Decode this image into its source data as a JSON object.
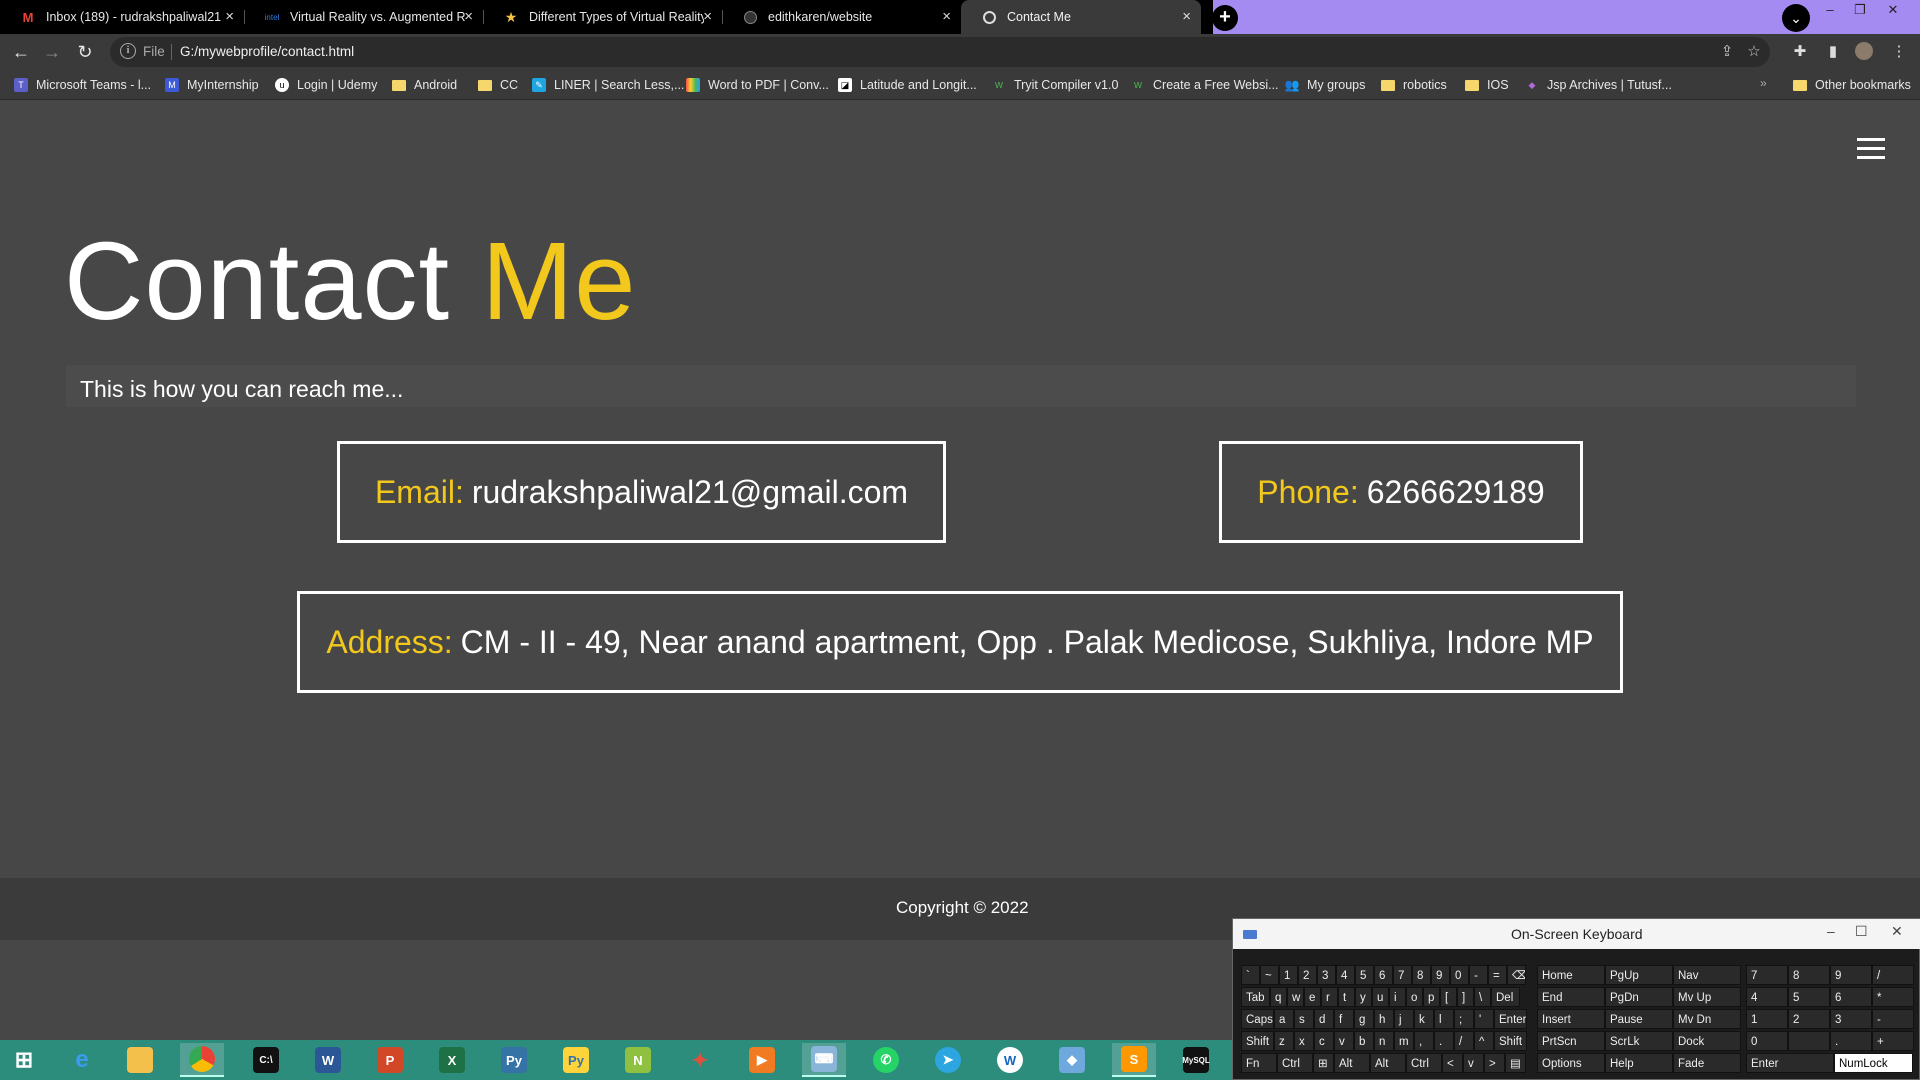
{
  "browser": {
    "tabs": [
      {
        "title": "Inbox (189) - rudrakshpaliwal21@",
        "icon": "gmail-icon",
        "active": false
      },
      {
        "title": "Virtual Reality vs. Augmented Re",
        "icon": "intel-icon",
        "active": false
      },
      {
        "title": "Different Types of Virtual Reality",
        "icon": "star-icon",
        "active": false
      },
      {
        "title": "edithkaren/website",
        "icon": "github-icon",
        "active": false
      },
      {
        "title": "Contact Me",
        "icon": "globe-icon",
        "active": true
      }
    ],
    "address": {
      "scheme": "File",
      "url": "G:/mywebprofile/contact.html"
    },
    "bookmarks": [
      {
        "label": "Microsoft Teams - l...",
        "icon": "teams-icon"
      },
      {
        "label": "MyInternship",
        "icon": "myinternship-icon"
      },
      {
        "label": "Login | Udemy",
        "icon": "udemy-icon"
      },
      {
        "label": "Android",
        "icon": "folder-icon"
      },
      {
        "label": "CC",
        "icon": "folder-icon"
      },
      {
        "label": "LINER | Search Less,...",
        "icon": "liner-icon"
      },
      {
        "label": "Word to PDF | Conv...",
        "icon": "pdf-icon"
      },
      {
        "label": "Latitude and Longit...",
        "icon": "map-icon"
      },
      {
        "label": "Tryit Compiler v1.0",
        "icon": "w3-icon"
      },
      {
        "label": "Create a Free Websi...",
        "icon": "w3-icon"
      },
      {
        "label": "My groups",
        "icon": "groups-icon"
      },
      {
        "label": "robotics",
        "icon": "folder-icon"
      },
      {
        "label": "IOS",
        "icon": "folder-icon"
      },
      {
        "label": "Jsp Archives | Tutusf...",
        "icon": "jsp-icon"
      }
    ],
    "bookmarks_more": "»",
    "other_bookmarks": "Other bookmarks"
  },
  "page": {
    "heading_main": "Contact",
    "heading_accent": "Me",
    "subline": "This is how you can reach me...",
    "email_label": "Email:",
    "email_value": "rudrakshpaliwal21@gmail.com",
    "phone_label": "Phone:",
    "phone_value": "6266629189",
    "address_label": "Address:",
    "address_value": "CM - II - 49, Near anand apartment, Opp . Palak Medicose, Sukhliya, Indore MP",
    "footer": "Copyright © 2022",
    "colors": {
      "accent": "#f2c81c",
      "background": "#474747"
    }
  },
  "osk": {
    "title": "On-Screen Keyboard",
    "rows": [
      [
        "`",
        "~",
        "1",
        "2",
        "3",
        "4",
        "5",
        "6",
        "7",
        "8",
        "9",
        "0",
        "-",
        "=",
        "⌫"
      ],
      [
        "Tab",
        "q",
        "w",
        "e",
        "r",
        "t",
        "y",
        "u",
        "i",
        "o",
        "p",
        "[",
        "]",
        "\\",
        "Del"
      ],
      [
        "Caps",
        "a",
        "s",
        "d",
        "f",
        "g",
        "h",
        "j",
        "k",
        "l",
        ";",
        "'",
        "Enter"
      ],
      [
        "Shift",
        "z",
        "x",
        "c",
        "v",
        "b",
        "n",
        "m",
        ",",
        ".",
        "/",
        "^",
        "Shift"
      ],
      [
        "Fn",
        "Ctrl",
        "⊞",
        "Alt",
        "Alt",
        "Ctrl",
        "<",
        "v",
        ">",
        "▤"
      ]
    ],
    "nav": [
      [
        "Home",
        "PgUp",
        "Nav"
      ],
      [
        "End",
        "PgDn",
        "Mv Up"
      ],
      [
        "Insert",
        "Pause",
        "Mv Dn"
      ],
      [
        "PrtScn",
        "ScrLk",
        "Dock"
      ],
      [
        "Options",
        "Help",
        "Fade"
      ]
    ],
    "numpad": [
      [
        "7",
        "8",
        "9",
        "/"
      ],
      [
        "4",
        "5",
        "6",
        "*"
      ],
      [
        "1",
        "2",
        "3",
        "-"
      ],
      [
        "0",
        "",
        ".",
        "+"
      ],
      [
        "Enter",
        "NumLock"
      ]
    ]
  },
  "taskbar": {
    "apps": [
      "windows-start-icon",
      "internet-explorer-icon",
      "file-explorer-icon",
      "chrome-icon",
      "terminal-icon",
      "word-icon",
      "powerpoint-icon",
      "excel-icon",
      "python-icon",
      "python-idle-icon",
      "notepad-plus-icon",
      "tool-icon",
      "media-player-icon",
      "on-screen-keyboard-icon",
      "whatsapp-icon",
      "telegram-icon",
      "app-icon",
      "virtualbox-icon",
      "sublime-text-icon",
      "mysql-icon"
    ]
  }
}
